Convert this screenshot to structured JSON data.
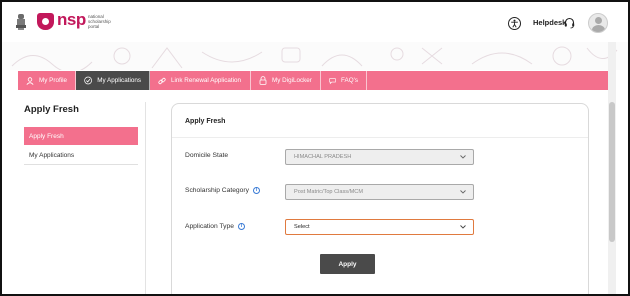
{
  "header": {
    "logo_text": "nsp",
    "logo_subtitle": "national scholarship portal",
    "helpdesk_label": "Helpdesk",
    "icons": [
      "state-emblem-icon",
      "nsp-logo-icon",
      "accessibility-icon",
      "headset-icon",
      "user-avatar"
    ]
  },
  "nav": {
    "items": [
      {
        "label": "My Profile",
        "icon": "user-icon"
      },
      {
        "label": "My Applications",
        "icon": "check-circle-icon"
      },
      {
        "label": "Link Renewal Application",
        "icon": "link-icon"
      },
      {
        "label": "My DigiLocker",
        "icon": "lock-icon"
      },
      {
        "label": "FAQ's",
        "icon": "chat-icon"
      }
    ],
    "active_index": 1
  },
  "sidebar": {
    "title": "Apply Fresh",
    "items": [
      {
        "label": "Apply Fresh",
        "active": true
      },
      {
        "label": "My Applications",
        "active": false
      }
    ]
  },
  "form": {
    "title": "Apply Fresh",
    "fields": [
      {
        "label": "Domicile State",
        "value": "HIMACHAL PRADESH",
        "state": "disabled",
        "info": false
      },
      {
        "label": "Scholarship Category",
        "value": "Post Matric/Top Class/MCM",
        "state": "disabled",
        "info": true
      },
      {
        "label": "Application Type",
        "value": "Select",
        "state": "focused",
        "info": true
      }
    ],
    "apply_label": "Apply"
  },
  "colors": {
    "brand_pink": "#f3708d",
    "logo_magenta": "#c2185b",
    "dark_button": "#4a4a4a",
    "focus_orange": "#e07a3f",
    "info_blue": "#3a7bd5"
  }
}
